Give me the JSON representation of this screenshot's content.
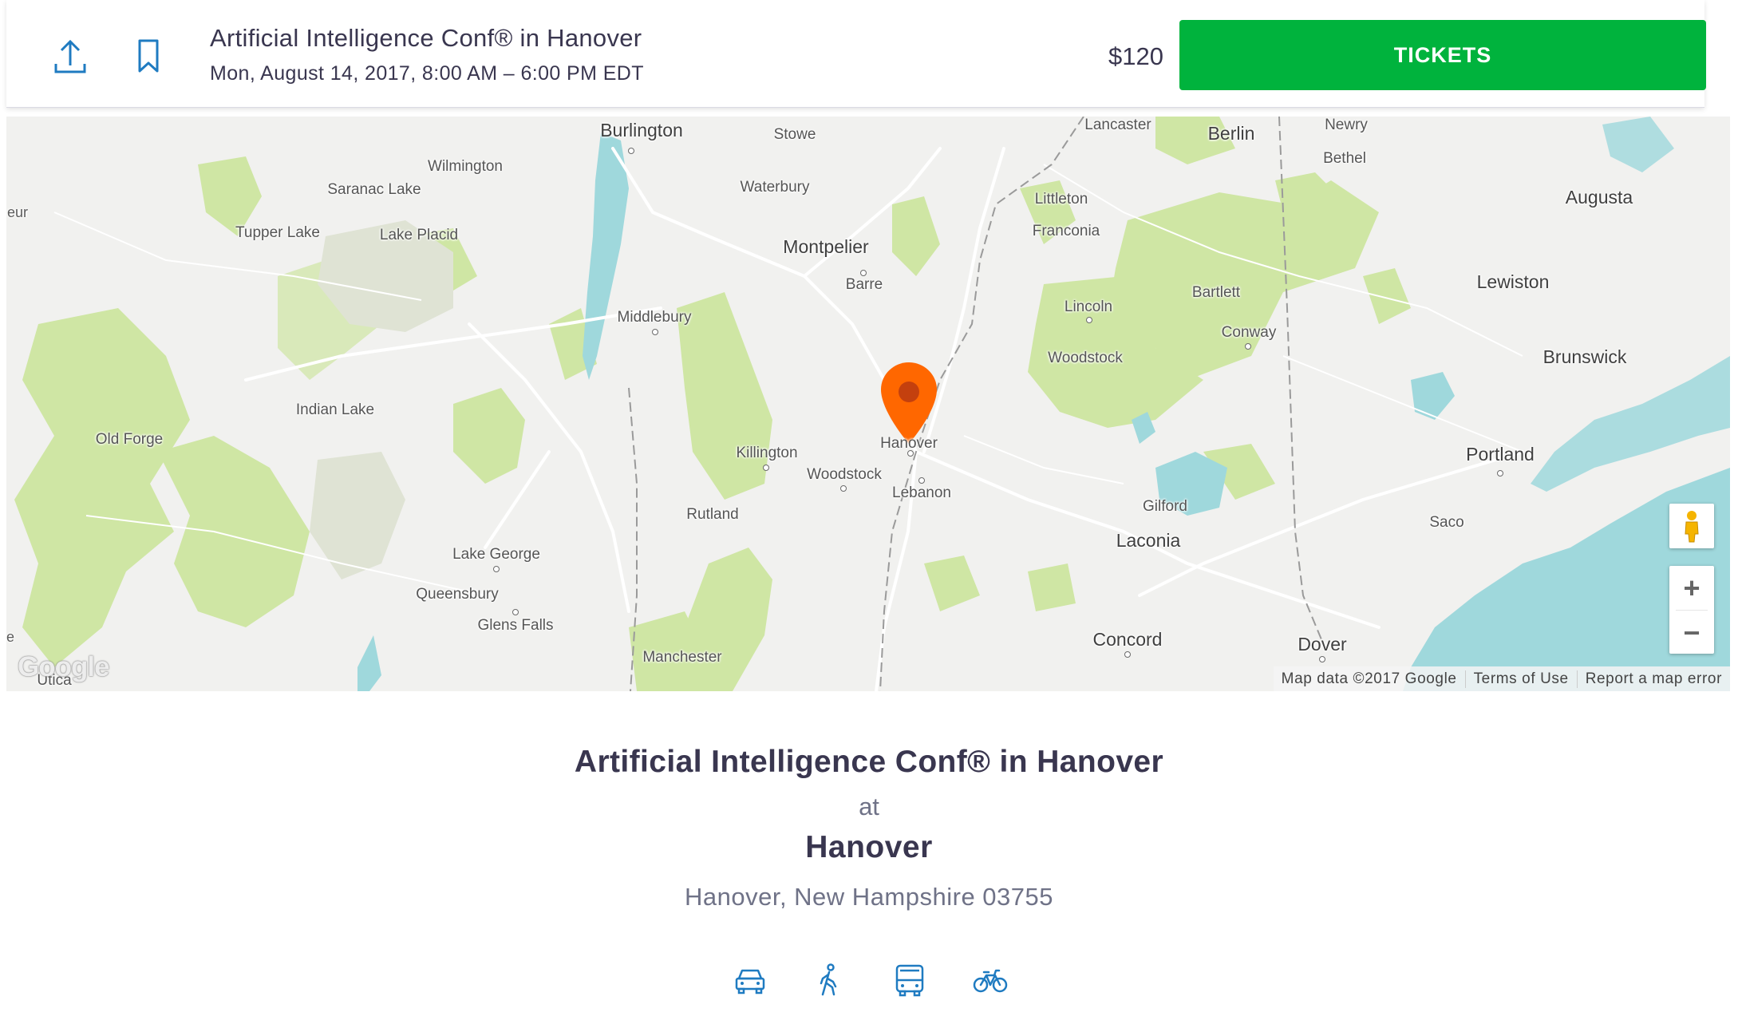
{
  "header": {
    "title": "Artificial Intelligence Conf® in Hanover",
    "date": "Mon, August 14, 2017, 8:00 AM – 6:00 PM EDT",
    "price": "$120",
    "tickets_label": "TICKETS",
    "icons": [
      "share-icon",
      "bookmark-icon"
    ]
  },
  "map": {
    "places": {
      "burlington": "Burlington",
      "stowe": "Stowe",
      "lancaster": "Lancaster",
      "berlin": "Berlin",
      "newry": "Newry",
      "bethel": "Bethel",
      "augusta": "Augusta",
      "wilmington": "Wilmington",
      "saranac_lake": "Saranac Lake",
      "waterbury": "Waterbury",
      "littleton": "Littleton",
      "eur": "eur",
      "tupper_lake": "Tupper Lake",
      "lake_placid": "Lake Placid",
      "montpelier": "Montpelier",
      "franconia": "Franconia",
      "barre": "Barre",
      "lewiston": "Lewiston",
      "bartlett": "Bartlett",
      "lincoln": "Lincoln",
      "middlebury": "Middlebury",
      "conway": "Conway",
      "woodstock_nh": "Woodstock",
      "brunswick": "Brunswick",
      "indian_lake": "Indian Lake",
      "old_forge": "Old Forge",
      "hanover": "Hanover",
      "killington": "Killington",
      "portland": "Portland",
      "woodstock_vt": "Woodstock",
      "lebanon": "Lebanon",
      "gilford": "Gilford",
      "rutland": "Rutland",
      "saco": "Saco",
      "laconia": "Laconia",
      "lake_george": "Lake George",
      "queensbury": "Queensbury",
      "glens_falls": "Glens Falls",
      "e": "e",
      "concord": "Concord",
      "dover": "Dover",
      "manchester": "Manchester",
      "utica": "Utica"
    },
    "google_logo": "Google",
    "map_data": "Map data ©2017 Google",
    "terms": "Terms of Use",
    "report": "Report a map error",
    "zoom_in": "+",
    "zoom_out": "−",
    "marker_icon": "map-pin-icon",
    "pegman_icon": "pegman-icon",
    "colors": {
      "park": "#cfe6a4",
      "water": "#9fd8dc",
      "land": "#f1f1ef",
      "marker": "#ff6700"
    }
  },
  "venue": {
    "title": "Artificial Intelligence Conf® in Hanover",
    "at": "at",
    "name": "Hanover",
    "address": "Hanover, New Hampshire 03755",
    "travel_icons": [
      "car-icon",
      "walk-icon",
      "bus-icon",
      "bike-icon"
    ]
  },
  "colors": {
    "tickets_green": "#00b33d",
    "icon_blue": "#1f7bc1",
    "text_dark": "#39364f"
  }
}
